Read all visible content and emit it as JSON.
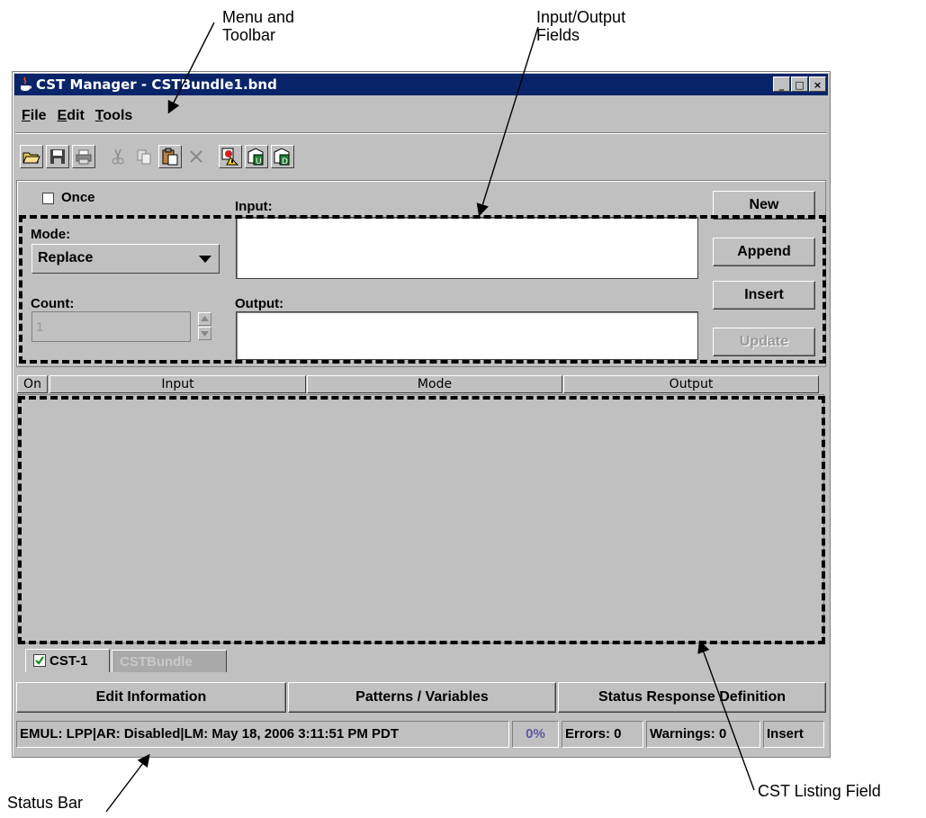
{
  "annotations": {
    "menu_toolbar": "Menu and\nToolbar",
    "io_fields": "Input/Output\nFields",
    "status_bar": "Status Bar",
    "cst_listing": "CST Listing Field"
  },
  "window": {
    "title": "CST Manager - CSTBundle1.bnd",
    "controls": [
      "_",
      "□",
      "×"
    ]
  },
  "menu": [
    {
      "mnemonic": "F",
      "rest": "ile"
    },
    {
      "mnemonic": "E",
      "rest": "dit"
    },
    {
      "mnemonic": "T",
      "rest": "ools"
    }
  ],
  "toolbar": {
    "icons": [
      "open-folder-icon",
      "save-icon",
      "print-icon",
      "cut-icon",
      "copy-icon",
      "paste-icon",
      "delete-icon",
      "validate-icon",
      "upload-icon",
      "download-icon"
    ]
  },
  "form": {
    "once_label": "Once",
    "once_checked": false,
    "input_label": "Input:",
    "input_value": "",
    "output_label": "Output:",
    "output_value": "",
    "mode_label": "Mode:",
    "mode_value": "Replace",
    "count_label": "Count:",
    "count_value": "1"
  },
  "buttons": {
    "new": "New",
    "append": "Append",
    "insert": "Insert",
    "update": "Update"
  },
  "table": {
    "columns": [
      "On",
      "Input",
      "Mode",
      "Output"
    ],
    "rows": []
  },
  "tabs": [
    {
      "label": "CST-1",
      "active": true,
      "checked": true
    },
    {
      "label": "CSTBundle",
      "active": false
    }
  ],
  "bottom_buttons": {
    "edit_info": "Edit Information",
    "patterns": "Patterns / Variables",
    "status_response": "Status Response Definition"
  },
  "status": {
    "info": "EMUL: LPP|AR: Disabled|LM: May 18, 2006 3:11:51 PM PDT",
    "progress": "0%",
    "errors": "Errors: 0",
    "warnings": "Warnings: 0",
    "mode": "Insert"
  },
  "colors": {
    "titlebar": "#0a246a",
    "window_bg": "#c0c0c0",
    "progress_text": "#5a5aa0"
  }
}
